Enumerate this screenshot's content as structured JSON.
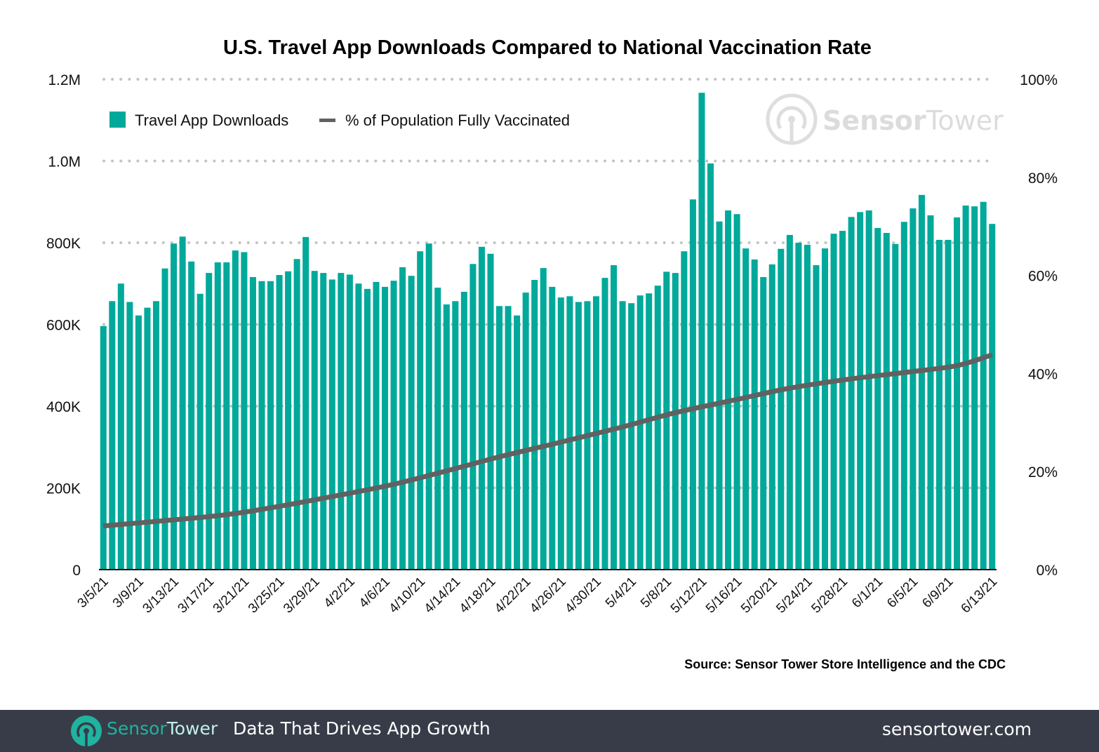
{
  "chart_data": {
    "type": "bar",
    "title": "U.S. Travel App Downloads Compared to National Vaccination Rate",
    "xlabel": "",
    "ylabel": "",
    "ylim": [
      0,
      1200000
    ],
    "y2lim": [
      0,
      100
    ],
    "grid": true,
    "legend_position": "top-left",
    "y_ticks": [
      {
        "value": 0,
        "label": "0"
      },
      {
        "value": 200000,
        "label": "200K"
      },
      {
        "value": 400000,
        "label": "400K"
      },
      {
        "value": 600000,
        "label": "600K"
      },
      {
        "value": 800000,
        "label": "800K"
      },
      {
        "value": 1000000,
        "label": "1.0M"
      },
      {
        "value": 1200000,
        "label": "1.2M"
      }
    ],
    "y2_ticks": [
      {
        "value": 0,
        "label": "0%"
      },
      {
        "value": 20,
        "label": "20%"
      },
      {
        "value": 40,
        "label": "40%"
      },
      {
        "value": 60,
        "label": "60%"
      },
      {
        "value": 80,
        "label": "80%"
      },
      {
        "value": 100,
        "label": "100%"
      }
    ],
    "x_tick_labels": [
      "3/5/21",
      "3/9/21",
      "3/13/21",
      "3/17/21",
      "3/21/21",
      "3/25/21",
      "3/29/21",
      "4/2/21",
      "4/6/21",
      "4/10/21",
      "4/14/21",
      "4/18/21",
      "4/22/21",
      "4/26/21",
      "4/30/21",
      "5/4/21",
      "5/8/21",
      "5/12/21",
      "5/16/21",
      "5/20/21",
      "5/24/21",
      "5/28/21",
      "6/1/21",
      "6/5/21",
      "6/9/21",
      "6/13/21"
    ],
    "x_tick_every": 4,
    "series": [
      {
        "name": "Travel App Downloads",
        "kind": "bar",
        "axis": "left",
        "color": "#00a99a",
        "values": [
          596000,
          657000,
          700000,
          655000,
          622000,
          641000,
          657000,
          737000,
          798000,
          815000,
          754000,
          675000,
          726000,
          752000,
          752000,
          781000,
          777000,
          716000,
          706000,
          706000,
          721000,
          730000,
          760000,
          814000,
          731000,
          726000,
          710000,
          726000,
          722000,
          700000,
          687000,
          704000,
          692000,
          707000,
          740000,
          719000,
          779000,
          798000,
          690000,
          649000,
          657000,
          680000,
          748000,
          790000,
          773000,
          645000,
          645000,
          622000,
          678000,
          709000,
          738000,
          692000,
          666000,
          669000,
          655000,
          657000,
          669000,
          714000,
          745000,
          657000,
          652000,
          671000,
          676000,
          695000,
          729000,
          726000,
          779000,
          906000,
          1167000,
          994000,
          852000,
          879000,
          870000,
          786000,
          759000,
          716000,
          747000,
          785000,
          819000,
          800000,
          795000,
          745000,
          786000,
          822000,
          829000,
          863000,
          875000,
          879000,
          836000,
          824000,
          797000,
          851000,
          884000,
          917000,
          867000,
          807000,
          807000,
          862000,
          891000,
          889000,
          900000,
          846000
        ]
      },
      {
        "name": "% of Population Fully Vaccinated",
        "kind": "line",
        "axis": "right",
        "color": "#616161",
        "points": [
          {
            "bar_index": 0,
            "value": 8.9
          },
          {
            "bar_index": 13,
            "value": 11.0
          },
          {
            "bar_index": 19,
            "value": 12.6
          },
          {
            "bar_index": 26,
            "value": 14.9
          },
          {
            "bar_index": 33,
            "value": 17.4
          },
          {
            "bar_index": 40,
            "value": 20.6
          },
          {
            "bar_index": 45,
            "value": 23.0
          },
          {
            "bar_index": 52,
            "value": 26.0
          },
          {
            "bar_index": 59,
            "value": 29.1
          },
          {
            "bar_index": 65,
            "value": 32.0
          },
          {
            "bar_index": 72,
            "value": 34.7
          },
          {
            "bar_index": 78,
            "value": 37.0
          },
          {
            "bar_index": 85,
            "value": 38.9
          },
          {
            "bar_index": 92,
            "value": 40.4
          },
          {
            "bar_index": 97,
            "value": 41.6
          },
          {
            "bar_index": 101,
            "value": 43.8
          }
        ]
      }
    ]
  },
  "legend": {
    "downloads_label": "Travel App Downloads",
    "vaccinated_label": "% of Population Fully Vaccinated"
  },
  "watermark": {
    "brand_bold": "Sensor",
    "brand_light": "Tower",
    "icon": "sensor-tower-logo-icon"
  },
  "source_note": "Source: Sensor Tower Store Intelligence and the CDC",
  "footer": {
    "brand_bold": "Sensor",
    "brand_light": "Tower",
    "tagline": "Data That Drives App Growth",
    "url": "sensortower.com",
    "background": "#383c48",
    "brand_color": "#1fb3a0"
  }
}
